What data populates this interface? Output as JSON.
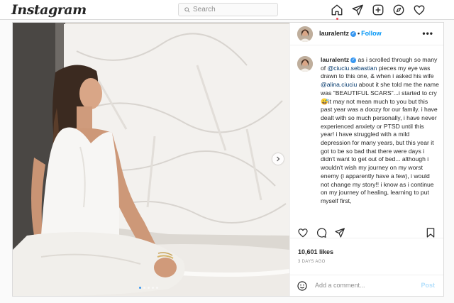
{
  "app": {
    "logo_text": "Instagram"
  },
  "search": {
    "placeholder": "Search"
  },
  "nav": {
    "icons": [
      "home-icon",
      "direct-message-icon",
      "new-post-icon",
      "explore-icon",
      "activity-heart-icon"
    ],
    "accent": "#ed4956"
  },
  "post": {
    "username": "lauralentz",
    "verified": true,
    "follow_label": "Follow",
    "more_label": "•••",
    "caption": {
      "username": "lauralentz",
      "seg1": " as i scrolled through so many of ",
      "mention1": "@ciuciu.sebastian",
      "seg2": " pieces my eye was drawn to this one, & when i asked his wife ",
      "mention2": "@alina.ciuciu",
      "seg3": " about it she told me the name was \"BEAUTIFUL SCARS\"...i started to cry 😅it may not mean much to you but this past year was a doozy for our family. i have dealt with so much personally, i have never experienced anxiety or PTSD until this year! i have struggled with a mild depression for many years, but this year it got to be so bad that there were days i didn't want to get out of bed... although i wouldn't wish my journey on my worst enemy (i apparently have a few), i would not change my story!! i know as i continue on my journey of healing, learning to put myself first,"
    },
    "likes": "10,601 likes",
    "posted": "3 DAYS AGO",
    "carousel": {
      "count": 5,
      "active_index": 0
    }
  },
  "comment": {
    "placeholder": "Add a comment...",
    "post_label": "Post"
  },
  "colors": {
    "link_blue": "#0095f6",
    "mention": "#00376b",
    "verified": "#3897f0",
    "muted": "#8e8e8e",
    "border": "#dbdbdb"
  }
}
